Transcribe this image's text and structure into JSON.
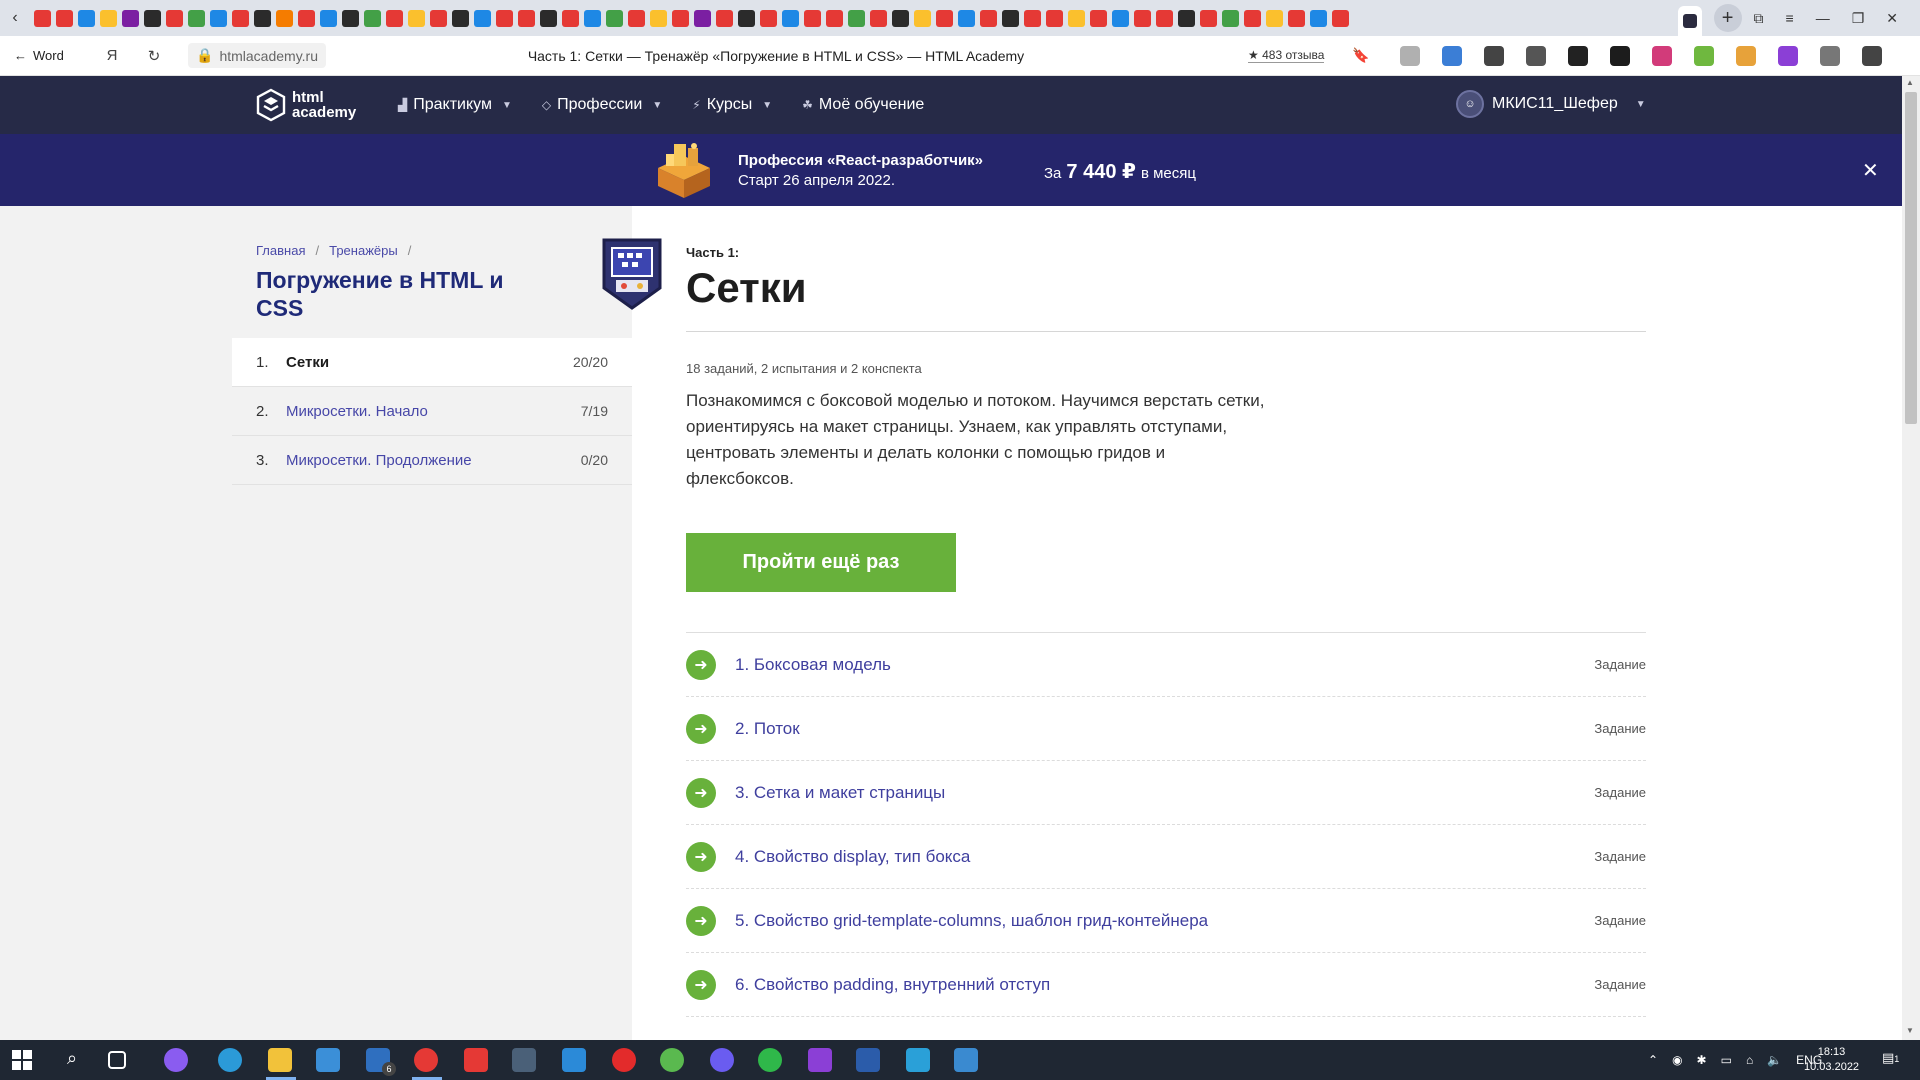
{
  "browser": {
    "back_label": "Word",
    "url": "htmlacademy.ru",
    "page_title": "Часть 1: Сетки — Тренажёр «Погружение в HTML и CSS» — HTML Academy",
    "reviews": "★ 483 отзыва",
    "tab_colors": [
      "#e53935",
      "#e53935",
      "#1e88e5",
      "#fbc02d",
      "#7b1fa2",
      "#2b2b2b",
      "#e53935",
      "#43a047",
      "#1e88e5",
      "#e53935",
      "#2b2b2b",
      "#f57c00",
      "#e53935",
      "#1e88e5",
      "#2b2b2b",
      "#43a047",
      "#e53935",
      "#fbc02d",
      "#e53935",
      "#2b2b2b",
      "#1e88e5",
      "#e53935",
      "#e53935",
      "#2b2b2b",
      "#e53935",
      "#1e88e5",
      "#43a047",
      "#e53935",
      "#fbc02d",
      "#e53935",
      "#7b1fa2",
      "#e53935",
      "#2b2b2b",
      "#e53935",
      "#1e88e5",
      "#e53935",
      "#e53935",
      "#43a047",
      "#e53935",
      "#2b2b2b",
      "#fbc02d",
      "#e53935",
      "#1e88e5",
      "#e53935",
      "#2b2b2b",
      "#e53935",
      "#e53935",
      "#fbc02d",
      "#e53935",
      "#1e88e5",
      "#e53935",
      "#e53935",
      "#2b2b2b",
      "#e53935",
      "#43a047",
      "#e53935",
      "#fbc02d",
      "#e53935",
      "#1e88e5",
      "#e53935"
    ]
  },
  "header": {
    "logo_line1": "html",
    "logo_line2": "academy",
    "nav": [
      {
        "icon": "▟",
        "label": "Практикум"
      },
      {
        "icon": "◇",
        "label": "Профессии"
      },
      {
        "icon": "⚡",
        "label": "Курсы"
      },
      {
        "icon": "☘",
        "label": "Моё обучение"
      }
    ],
    "user_name": "МКИС11_Шефер",
    "avatar_text": "☺"
  },
  "promo": {
    "title": "Профессия «React-разработчик»",
    "start": "Старт 26 апреля 2022.",
    "price_prefix": "За",
    "price": "7 440 ₽",
    "price_suffix": "в месяц",
    "close": "✕"
  },
  "sidebar": {
    "breadcrumbs": [
      {
        "label": "Главная"
      },
      {
        "label": "Тренажёры"
      }
    ],
    "course_title": "Погружение в HTML и CSS",
    "lessons": [
      {
        "num": "1.",
        "name": "Сетки",
        "progress": "20/20"
      },
      {
        "num": "2.",
        "name": "Микросетки. Начало",
        "progress": "7/19"
      },
      {
        "num": "3.",
        "name": "Микросетки. Продолжение",
        "progress": "0/20"
      }
    ]
  },
  "main": {
    "part_label": "Часть 1:",
    "title": "Сетки",
    "meta": "18 заданий, 2 испытания и 2 конспекта",
    "description": "Познакомимся с боксовой моделью и потоком. Научимся верстать сетки, ориентируясь на макет страницы. Узнаем, как управлять отступами, центровать элементы и делать колонки с помощью гридов и флексбоксов.",
    "retry_button": "Пройти ещё раз",
    "tasks": [
      {
        "name": "1. Боксовая модель",
        "type": "Задание"
      },
      {
        "name": "2. Поток",
        "type": "Задание"
      },
      {
        "name": "3. Сетка и макет страницы",
        "type": "Задание"
      },
      {
        "name": "4. Свойство display, тип бокса",
        "type": "Задание"
      },
      {
        "name": "5. Свойство grid-template-columns, шаблон грид-контейнера",
        "type": "Задание"
      },
      {
        "name": "6. Свойство padding, внутренний отступ",
        "type": "Задание"
      }
    ]
  },
  "taskbar": {
    "lang": "ENG",
    "time": "18:13",
    "date": "10.03.2022",
    "mail_badge": "6",
    "notifications": "1"
  },
  "colors": {
    "header_bg": "#262a47",
    "promo_bg": "#25256b",
    "accent_green": "#68b13b",
    "title_blue": "#1f2a78",
    "link_blue": "#3f3f9e"
  }
}
